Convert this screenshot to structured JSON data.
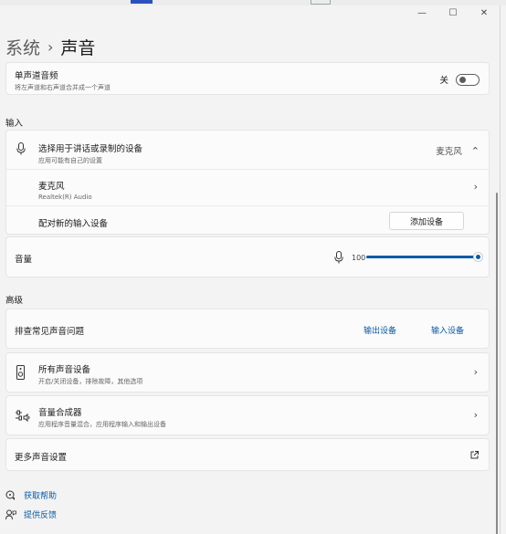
{
  "window": {
    "controls": [
      "—",
      "☐",
      "✕"
    ]
  },
  "breadcrumb": {
    "parent": "系统",
    "separator": "›",
    "current": "声音"
  },
  "mono": {
    "title": "单声道音频",
    "subtitle": "将左声道和右声道合并成一个声道",
    "state_label": "关"
  },
  "input": {
    "section_label": "输入",
    "choose_title": "选择用于讲话或录制的设备",
    "choose_subtitle": "应用可能有自己的设置",
    "selected_device": "麦克风",
    "device_name": "麦克风",
    "device_sub": "Realtek(R) Audio",
    "pair_label": "配对新的输入设备",
    "add_button": "添加设备",
    "volume_label": "音量",
    "volume_value": "100"
  },
  "advanced": {
    "section_label": "高级",
    "troubleshoot_title": "排查常见声音问题",
    "output_link": "输出设备",
    "input_link": "输入设备",
    "all_devices_title": "所有声音设备",
    "all_devices_sub": "开启/关闭设备，排除故障，其他选项",
    "mixer_title": "音量合成器",
    "mixer_sub": "应用程序音量混合，应用程序输入和输出设备",
    "more_settings": "更多声音设置"
  },
  "help": {
    "get_help": "获取帮助",
    "feedback": "提供反馈"
  }
}
